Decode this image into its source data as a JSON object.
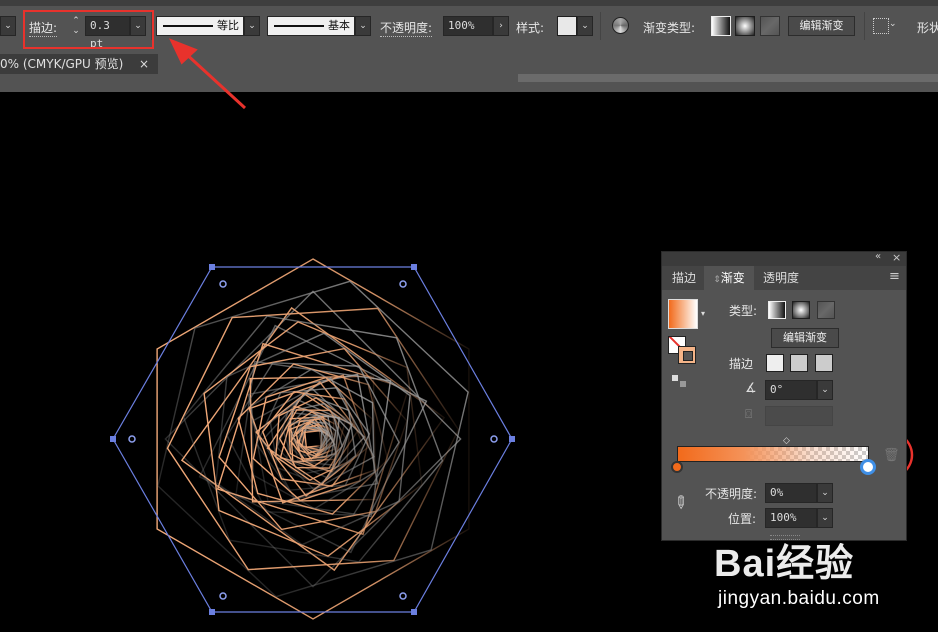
{
  "control_bar": {
    "stroke_label": "描边:",
    "stroke_value": "0.3 pt",
    "profile1_label": "等比",
    "profile2_label": "基本",
    "opacity_label": "不透明度:",
    "opacity_value": "100%",
    "style_label": "样式:",
    "gradient_type_label": "渐变类型:",
    "edit_gradient_label": "编辑渐变",
    "shape_label": "形状"
  },
  "document_tab": {
    "title": "0% (CMYK/GPU 预览)",
    "close_symbol": "×"
  },
  "gradient_panel": {
    "tabs": [
      "描边",
      "渐变",
      "透明度"
    ],
    "active_tab": "渐变",
    "collapse_symbol": "«",
    "close_symbol": "×",
    "menu_symbol": "≡",
    "type_label": "类型:",
    "edit_gradient_label": "编辑渐变",
    "stroke_label": "描边",
    "angle_value": "0°",
    "opacity_label": "不透明度:",
    "opacity_value": "0%",
    "position_label": "位置:",
    "position_value": "100%",
    "gradient_start_color": "#f26a1b",
    "gradient_end_opacity": 0
  },
  "colors": {
    "accent_red": "#e8322c",
    "selection_blue": "#6b7fe0",
    "stroke_orange": "#e8a070"
  },
  "watermark": {
    "logo": "Bai经验",
    "url": "jingyan.baidu.com"
  }
}
